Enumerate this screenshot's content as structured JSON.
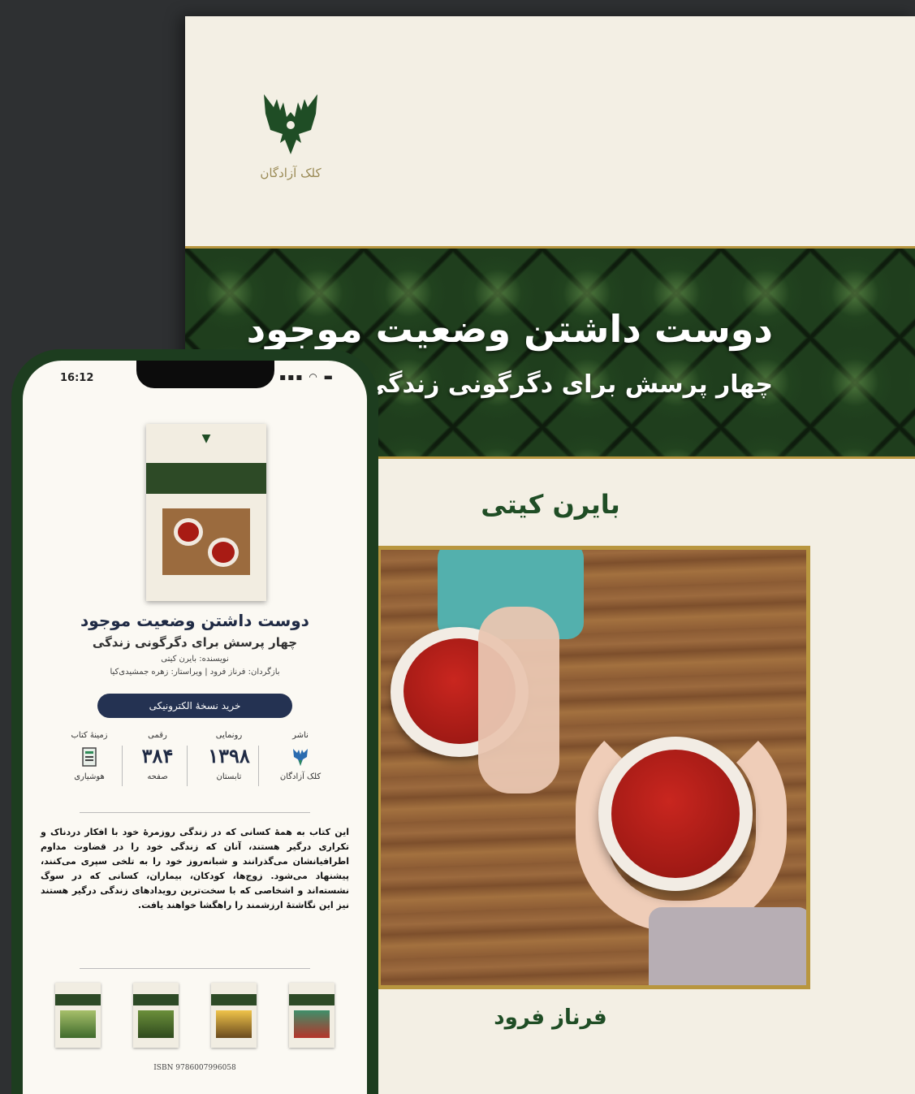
{
  "cover": {
    "publisher_logo_text": "کلک آزادگان",
    "title": "دوست داشتن وضعیت موجود",
    "subtitle": "چهار پرسش برای دگرگونی زندگی",
    "author": "بایرن کیتی",
    "translator": "فرناز فرود"
  },
  "phone": {
    "status_time": "16:12",
    "status_icons": "▪▪▪ ◠ ▬",
    "book_title": "دوست داشتن وضعیت موجود",
    "book_subtitle": "چهار پرسش برای دگرگونی زندگی",
    "author_line": "نویسنده: بایرن کیتی",
    "credits_line": "بازگردان: فرناز فرود | ویراستار: زهره جمشیدی‌کیا",
    "buy_button": "خرید نسخهٔ الکترونیکی",
    "stats": [
      {
        "label": "ناشر",
        "value": "",
        "caption": "کلک آزادگان",
        "icon": "publisher-logo-icon"
      },
      {
        "label": "رونمایی",
        "value": "۱۳۹۸",
        "caption": "تابستان"
      },
      {
        "label": "رقمی",
        "value": "۳۸۴",
        "caption": "صفحه"
      },
      {
        "label": "زمینهٔ کتاب",
        "value": "",
        "caption": "هوشیاری",
        "icon": "book-category-icon"
      }
    ],
    "description": "این کتاب به همهٔ کسانی که در زندگی روزمرهٔ خود با افکار دردناک و تکراری درگیر هستند، آنان که زندگی خود را در قضاوت مداوم اطرافیانشان می‌گذرانند و شبانه‌روز خود را به تلخی سپری می‌کنند، پیشنهاد می‌شود. زوج‌ها، کودکان، بیماران، کسانی که در سوگ نشسته‌اند و اشخاصی که با سخت‌ترین رویدادهای زندگی درگیر هستند نیز این نگاشتهٔ ارزشمند را راهگشا خواهند یافت.",
    "isbn": "ISBN 9786007996058"
  },
  "colors": {
    "accent_green": "#1f4d25",
    "button_navy": "#243252",
    "gold_frame": "#b8963f"
  }
}
